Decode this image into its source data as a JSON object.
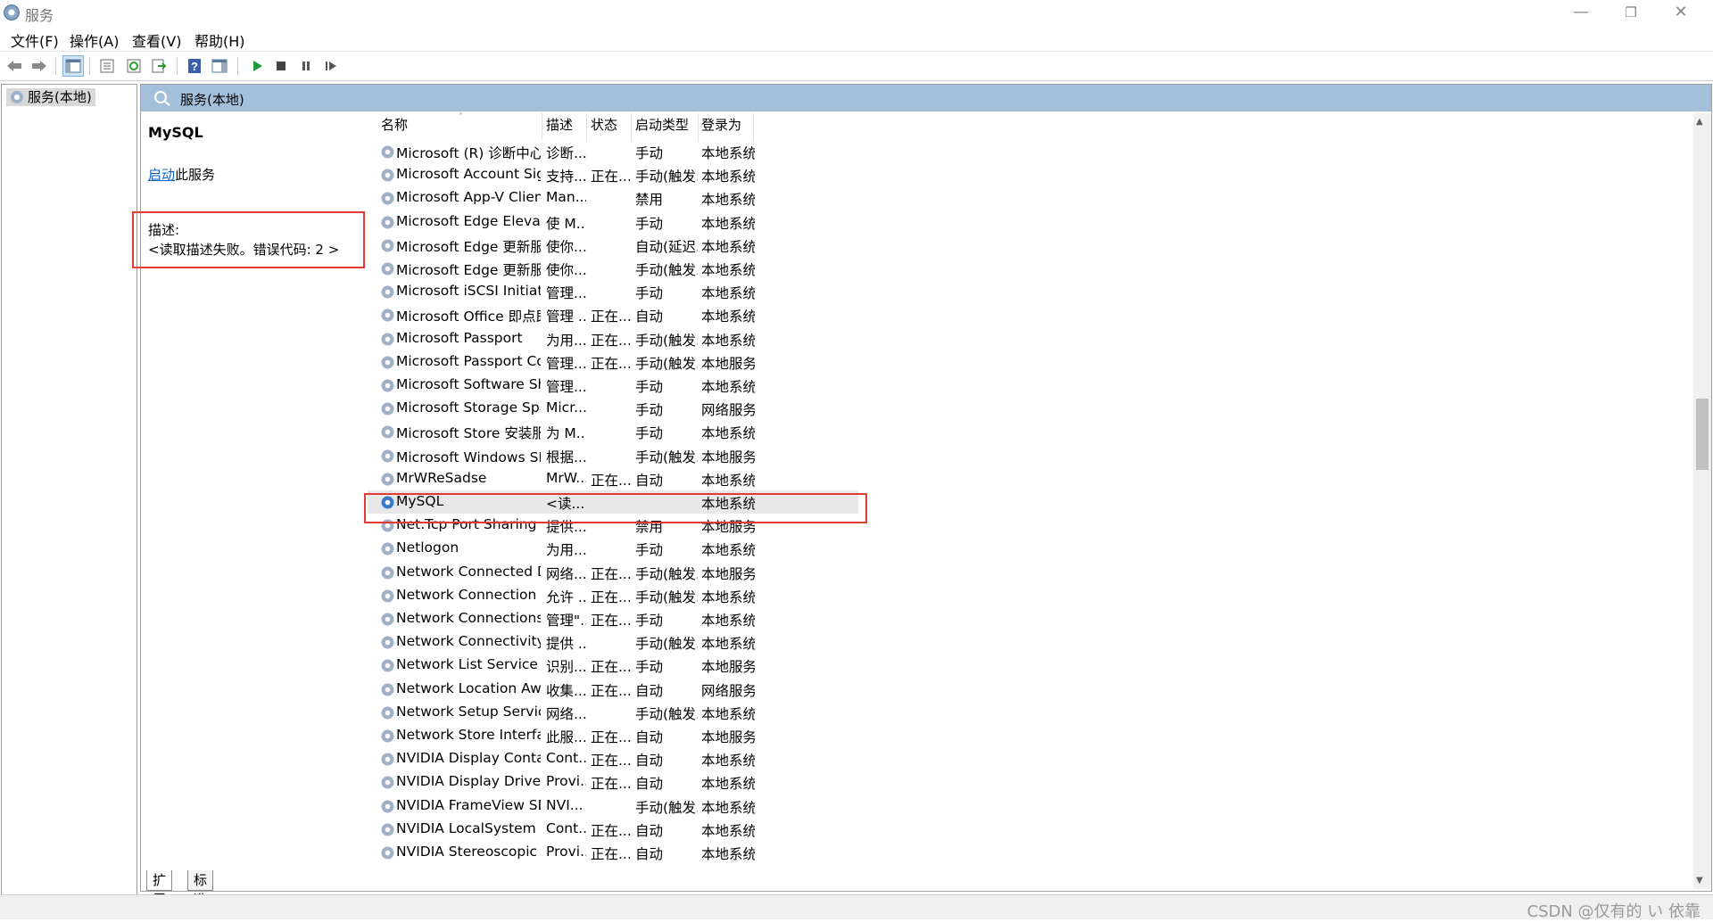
{
  "window": {
    "title": "服务",
    "minimize": "—",
    "restore": "❐",
    "close": "✕"
  },
  "menu": [
    "文件(F)",
    "操作(A)",
    "查看(V)",
    "帮助(H)"
  ],
  "tree": {
    "root_label": "服务(本地)"
  },
  "panel": {
    "header_title": "服务(本地)"
  },
  "detail": {
    "service_name": "MySQL",
    "start_link": "启动",
    "start_suffix": "此服务",
    "desc_label": "描述:",
    "desc_text": "<读取描述失败。错误代码: 2 >"
  },
  "columns": {
    "name": "名称",
    "desc": "描述",
    "status": "状态",
    "startup": "启动类型",
    "logon": "登录为"
  },
  "services": [
    {
      "name": "Microsoft (R) 诊断中心标准...",
      "desc": "诊断...",
      "status": "",
      "startup": "手动",
      "logon": "本地系统"
    },
    {
      "name": "Microsoft Account Sign-in ...",
      "desc": "支持...",
      "status": "正在...",
      "startup": "手动(触发...",
      "logon": "本地系统"
    },
    {
      "name": "Microsoft App-V Client",
      "desc": "Man...",
      "status": "",
      "startup": "禁用",
      "logon": "本地系统"
    },
    {
      "name": "Microsoft Edge Elevation S...",
      "desc": "使 M...",
      "status": "",
      "startup": "手动",
      "logon": "本地系统"
    },
    {
      "name": "Microsoft Edge 更新服务 (...",
      "desc": "使你...",
      "status": "",
      "startup": "自动(延迟...",
      "logon": "本地系统"
    },
    {
      "name": "Microsoft Edge 更新服务 (...",
      "desc": "使你...",
      "status": "",
      "startup": "手动(触发...",
      "logon": "本地系统"
    },
    {
      "name": "Microsoft iSCSI Initiator Ser...",
      "desc": "管理...",
      "status": "",
      "startup": "手动",
      "logon": "本地系统"
    },
    {
      "name": "Microsoft Office 即点即用...",
      "desc": "管理 ...",
      "status": "正在...",
      "startup": "自动",
      "logon": "本地系统"
    },
    {
      "name": "Microsoft Passport",
      "desc": "为用...",
      "status": "正在...",
      "startup": "手动(触发...",
      "logon": "本地系统"
    },
    {
      "name": "Microsoft Passport Container",
      "desc": "管理...",
      "status": "正在...",
      "startup": "手动(触发...",
      "logon": "本地服务"
    },
    {
      "name": "Microsoft Software Shado...",
      "desc": "管理...",
      "status": "",
      "startup": "手动",
      "logon": "本地系统"
    },
    {
      "name": "Microsoft Storage Spaces S...",
      "desc": "Micr...",
      "status": "",
      "startup": "手动",
      "logon": "网络服务"
    },
    {
      "name": "Microsoft Store 安装服务",
      "desc": "为 M...",
      "status": "",
      "startup": "手动",
      "logon": "本地系统"
    },
    {
      "name": "Microsoft Windows SMS 路...",
      "desc": "根据...",
      "status": "",
      "startup": "手动(触发...",
      "logon": "本地服务"
    },
    {
      "name": "MrWReSadse",
      "desc": "MrW...",
      "status": "正在...",
      "startup": "自动",
      "logon": "本地系统"
    },
    {
      "name": "MySQL",
      "desc": "<读...",
      "status": "",
      "startup": "",
      "logon": "本地系统",
      "selected": true
    },
    {
      "name": "Net.Tcp Port Sharing Service",
      "desc": "提供...",
      "status": "",
      "startup": "禁用",
      "logon": "本地服务"
    },
    {
      "name": "Netlogon",
      "desc": "为用...",
      "status": "",
      "startup": "手动",
      "logon": "本地系统"
    },
    {
      "name": "Network Connected Devic...",
      "desc": "网络...",
      "status": "正在...",
      "startup": "手动(触发...",
      "logon": "本地服务"
    },
    {
      "name": "Network Connection Broker",
      "desc": "允许 ...",
      "status": "正在...",
      "startup": "手动(触发...",
      "logon": "本地系统"
    },
    {
      "name": "Network Connections",
      "desc": "管理\"...",
      "status": "正在...",
      "startup": "手动",
      "logon": "本地系统"
    },
    {
      "name": "Network Connectivity Assis...",
      "desc": "提供 ...",
      "status": "",
      "startup": "手动(触发...",
      "logon": "本地系统"
    },
    {
      "name": "Network List Service",
      "desc": "识别...",
      "status": "正在...",
      "startup": "手动",
      "logon": "本地服务"
    },
    {
      "name": "Network Location Awarene...",
      "desc": "收集...",
      "status": "正在...",
      "startup": "自动",
      "logon": "网络服务"
    },
    {
      "name": "Network Setup Service",
      "desc": "网络...",
      "status": "",
      "startup": "手动(触发...",
      "logon": "本地系统"
    },
    {
      "name": "Network Store Interface Se...",
      "desc": "此服...",
      "status": "正在...",
      "startup": "自动",
      "logon": "本地服务"
    },
    {
      "name": "NVIDIA Display Container LS",
      "desc": "Cont...",
      "status": "正在...",
      "startup": "自动",
      "logon": "本地系统"
    },
    {
      "name": "NVIDIA Display Driver Serv...",
      "desc": "Provi...",
      "status": "正在...",
      "startup": "自动",
      "logon": "本地系统"
    },
    {
      "name": "NVIDIA FrameView SDK se...",
      "desc": "NVI...",
      "status": "",
      "startup": "手动(触发...",
      "logon": "本地系统"
    },
    {
      "name": "NVIDIA LocalSystem Conta...",
      "desc": "Cont...",
      "status": "正在...",
      "startup": "自动",
      "logon": "本地系统"
    },
    {
      "name": "NVIDIA Stereoscopic 3D D...",
      "desc": "Provi...",
      "status": "正在...",
      "startup": "自动",
      "logon": "本地系统"
    }
  ],
  "tabs": {
    "extended": "扩展",
    "standard": "标准"
  },
  "watermark": "CSDN @仅有的 い 依靠"
}
